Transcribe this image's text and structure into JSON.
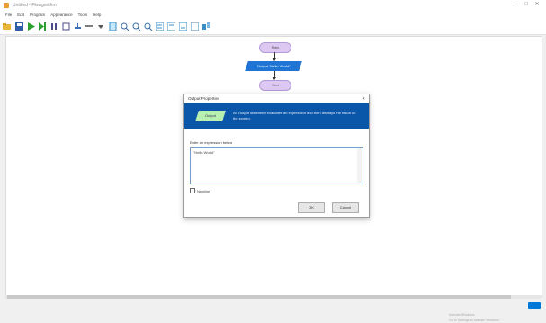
{
  "window": {
    "title": "Untitled - Flowgorithm",
    "minimize": "–",
    "maximize": "□",
    "close": "✕"
  },
  "menu": [
    "File",
    "Edit",
    "Program",
    "Appearance",
    "Tools",
    "Help"
  ],
  "toolbar": {
    "icons": [
      "folder-open-icon",
      "save-icon",
      "run-icon",
      "step-icon",
      "pause-icon",
      "stop-icon",
      "variable-watch-icon",
      "console-icon",
      "zoom-dropdown-icon",
      "layout-icon",
      "zoom-in-icon",
      "zoom-out-icon",
      "zoom-fit-icon",
      "code-view-icon",
      "diagram-icon",
      "chart-icon",
      "chart2-icon",
      "settings-icon"
    ]
  },
  "flowchart": {
    "start": "Main",
    "io": "Output \"Hello World\"",
    "end": "End"
  },
  "dialog": {
    "title": "Output Properties",
    "close": "✕",
    "shape_label": "Output",
    "banner_text": "An Output statement evaluates an expression and then displays the result on the screen.",
    "field_label": "Enter an expression below",
    "field_value": "\"Hello World\"",
    "checkbox_label": "Newline",
    "ok": "OK",
    "cancel": "Cancel"
  },
  "activation": {
    "line1": "Activate Windows",
    "line2": "Go to Settings to activate Windows."
  },
  "colors": {
    "accent": "#0a56a8",
    "terminal": "#dcc8f0",
    "io": "#1f74d4",
    "banner_shape": "#b8f0b0"
  }
}
